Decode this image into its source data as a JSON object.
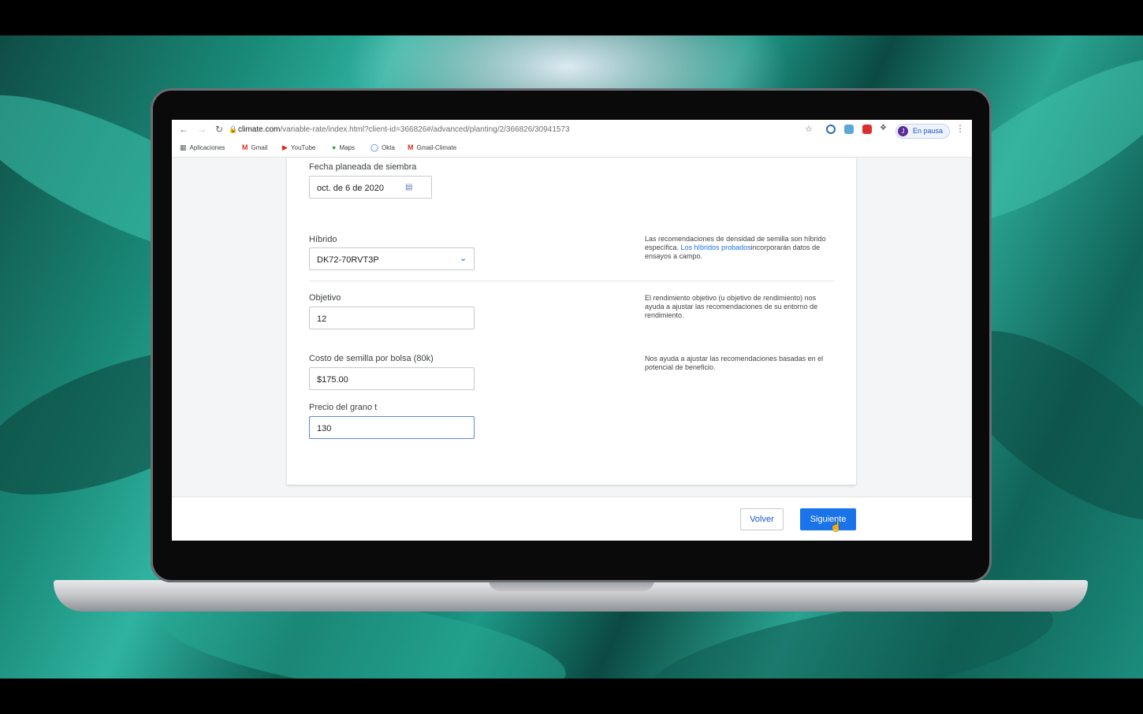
{
  "browser": {
    "url_domain": "climate.com",
    "url_path": "/variable-rate/index.html?client-id=366826#/advanced/planting/2/366826/30941573",
    "profile_initial": "J",
    "profile_status": "En pausa",
    "bookmarks": [
      {
        "label": "Aplicaciones",
        "icon": "apps-grid-icon"
      },
      {
        "label": "Gmail",
        "icon": "gmail-icon"
      },
      {
        "label": "YouTube",
        "icon": "youtube-icon"
      },
      {
        "label": "Maps",
        "icon": "maps-pin-icon"
      },
      {
        "label": "Okta",
        "icon": "okta-icon"
      },
      {
        "label": "Gmail-Climate",
        "icon": "gmail-icon"
      }
    ]
  },
  "form": {
    "planting_date": {
      "label": "Fecha planeada de siembra",
      "value": "oct. de 6 de 2020"
    },
    "hybrid": {
      "label": "Híbrido",
      "value": "DK72-70RVT3P",
      "help_before": "Las recomendaciones de densidad de semilla son híbrido específica. ",
      "help_link": "Los híbridos probados",
      "help_after": "incorporarán datos de ensayos a campo."
    },
    "objective": {
      "label": "Objetivo",
      "value": "12",
      "help": "El rendimiento objetivo (u objetivo de rendimiento) nos ayuda a ajustar las recomendaciones de su entorno de rendimiento."
    },
    "seed_cost": {
      "label": "Costo de semilla por bolsa (80k)",
      "value": "$175.00",
      "help": "Nos ayuda a ajustar las recomendaciones basadas en el potencial de beneficio."
    },
    "grain_price": {
      "label": "Precio del grano t",
      "value": "130"
    }
  },
  "footer": {
    "back_label": "Volver",
    "next_label": "Siguiente"
  },
  "colors": {
    "primary": "#1a73e8",
    "link": "#1a73e8"
  }
}
